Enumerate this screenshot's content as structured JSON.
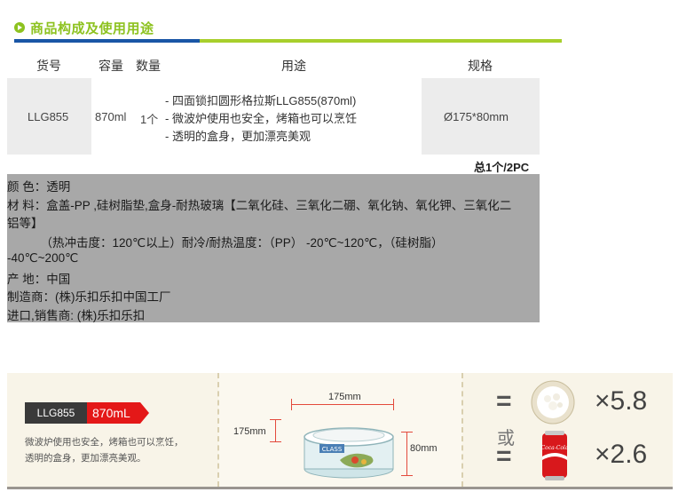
{
  "section": {
    "title": "商品构成及使用用途"
  },
  "table": {
    "headers": {
      "code": "货号",
      "capacity": "容量",
      "quantity": "数量",
      "usage": "用途",
      "spec": "规格"
    },
    "row": {
      "code": "LLG855",
      "capacity": "870ml",
      "quantity": "1个",
      "usage": [
        "- 四面锁扣圆形格拉斯LLG855(870ml)",
        "- 微波炉使用也安全，烤箱也可以烹饪",
        "- 透明的盒身，更加漂亮美观"
      ],
      "spec": "Ø175*80mm"
    },
    "total": "总1个/2PC"
  },
  "spec_lines": [
    "颜 色：透明",
    "材 料：盒盖-PP ,硅树脂垫,盒身-耐热玻璃【二氧化硅、三氧化二硼、氧化钠、氧化钾、三氧化二",
    "铝等】",
    "          （热冲击度：120℃以上）耐冷/耐热温度：（PP） -20℃~120℃，（硅树脂）",
    "-40℃~200℃",
    "产 地：中国",
    "制造商：(株)乐扣乐扣中国工厂",
    "进口,销售商: (株)乐扣乐扣"
  ],
  "banner": {
    "model": "LLG855",
    "volume": "870mL",
    "notes": [
      "微波炉使用也安全，烤箱也可以烹饪，",
      "透明的盒身，更加漂亮美观。"
    ],
    "dims": {
      "width": "175mm",
      "depth": "175mm",
      "height": "80mm"
    },
    "box_label": "CLASS",
    "eq": "=",
    "or": "或",
    "rice_multiplier": "×5.8",
    "can_multiplier": "×2.6",
    "can_brand": "Coca-Cola",
    "colors": {
      "accent_green": "#8dc21f",
      "accent_blue": "#1a56a6",
      "red": "#e41818"
    }
  }
}
